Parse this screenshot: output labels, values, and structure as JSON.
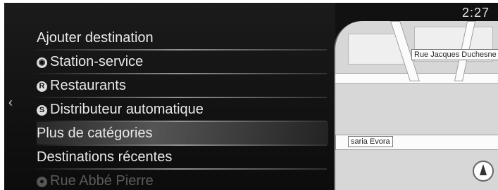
{
  "status": {
    "clock": "2:27"
  },
  "menu": {
    "back_icon": "chevron-left-icon",
    "items": [
      {
        "label": "Ajouter destination",
        "icon": null
      },
      {
        "label": "Station-service",
        "icon": "fuel-station-icon"
      },
      {
        "label": "Restaurants",
        "icon": "restaurant-icon"
      },
      {
        "label": "Distributeur automatique",
        "icon": "atm-icon"
      },
      {
        "label": "Plus de catégories",
        "icon": null,
        "selected": true
      },
      {
        "label": "Destinations récentes",
        "icon": null
      },
      {
        "label": "Rue Abbé Pierre",
        "icon": "recent-place-icon"
      }
    ]
  },
  "map": {
    "street_top": "Rue Jacques Duchesne",
    "street_bottom": "saria Evora",
    "compass": "compass-icon"
  }
}
